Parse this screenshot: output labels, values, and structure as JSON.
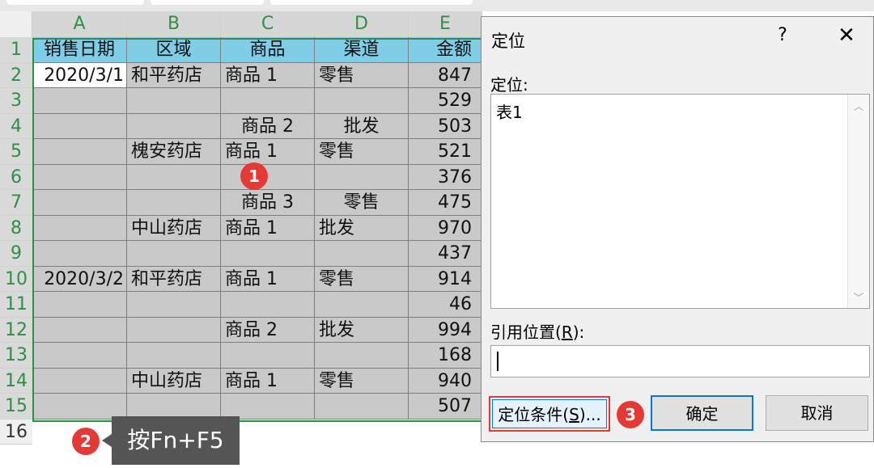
{
  "columns": [
    "A",
    "B",
    "C",
    "D",
    "E"
  ],
  "rows": [
    "1",
    "2",
    "3",
    "4",
    "5",
    "6",
    "7",
    "8",
    "9",
    "10",
    "11",
    "12",
    "13",
    "14",
    "15",
    "16"
  ],
  "table": {
    "headers": [
      "销售日期",
      "区域",
      "商品",
      "渠道",
      "金额"
    ],
    "data": [
      [
        "2020/3/1",
        "和平药店",
        "商品 1",
        "零售",
        "847"
      ],
      [
        "",
        "",
        "",
        "",
        "529"
      ],
      [
        "",
        "",
        "商品 2",
        "批发",
        "503"
      ],
      [
        "",
        "槐安药店",
        "商品 1",
        "零售",
        "521"
      ],
      [
        "",
        "",
        "",
        "",
        "376"
      ],
      [
        "",
        "",
        "商品 3",
        "零售",
        "475"
      ],
      [
        "",
        "中山药店",
        "商品 1",
        "批发",
        "970"
      ],
      [
        "",
        "",
        "",
        "",
        "437"
      ],
      [
        "2020/3/2",
        "和平药店",
        "商品 1",
        "零售",
        "914"
      ],
      [
        "",
        "",
        "",
        "",
        "46"
      ],
      [
        "",
        "",
        "商品 2",
        "批发",
        "994"
      ],
      [
        "",
        "",
        "",
        "",
        "168"
      ],
      [
        "",
        "中山药店",
        "商品 1",
        "零售",
        "940"
      ],
      [
        "",
        "",
        "",
        "",
        "507"
      ]
    ]
  },
  "annotations": {
    "badge1": "1",
    "badge2": "2",
    "badge3": "3",
    "tooltip": "按Fn+F5"
  },
  "dialog": {
    "title": "定位",
    "help": "?",
    "close": "✕",
    "goto_label": "定位:",
    "list_items": [
      "表1"
    ],
    "ref_label_pre": "引用位置(",
    "ref_label_key": "R",
    "ref_label_post": "):",
    "ref_value": "",
    "special_pre": "定位条件(",
    "special_key": "S",
    "special_post": ")...",
    "ok": "确定",
    "cancel": "取消"
  },
  "colors": {
    "header_fill": "#7fcde6",
    "selected_fill": "#c9c9c9",
    "selection_border": "#2f8f46",
    "badge": "#e53935"
  }
}
